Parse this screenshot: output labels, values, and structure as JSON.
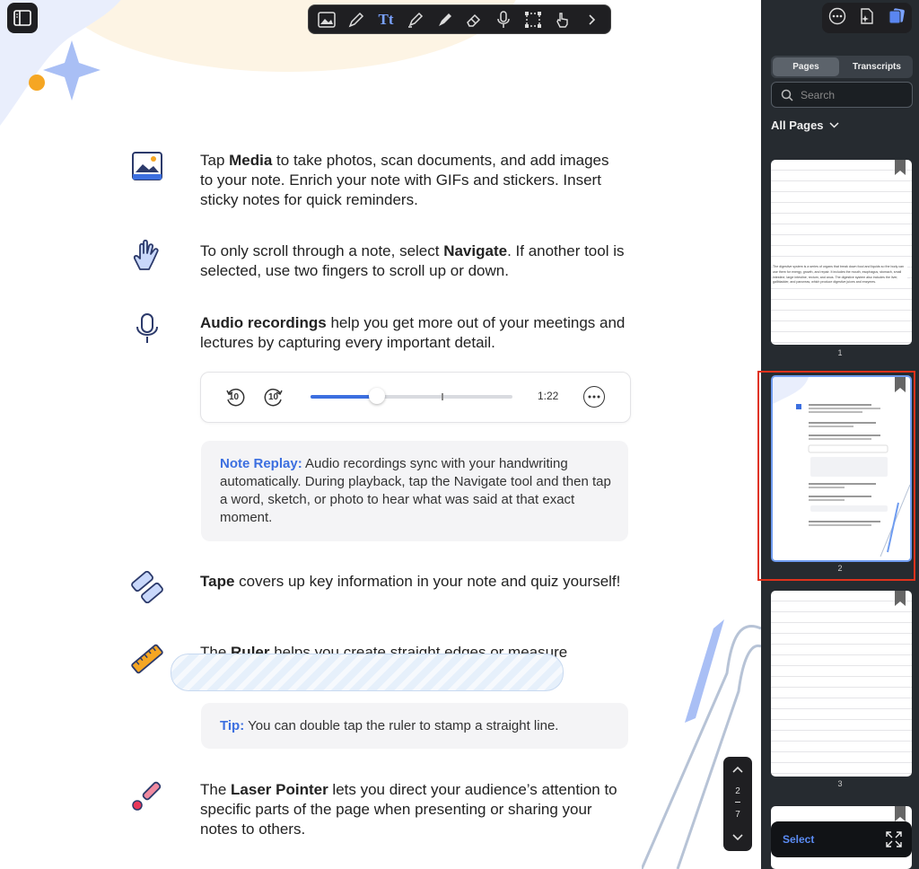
{
  "toolbar": {
    "tools": [
      "media-icon",
      "pen-icon",
      "text-icon",
      "highlighter-icon",
      "marker-icon",
      "eraser-icon",
      "microphone-icon",
      "lasso-icon",
      "navigate-icon",
      "chevron-right-icon"
    ]
  },
  "content": {
    "media": {
      "pre": "Tap ",
      "bold": "Media",
      "post": " to take photos, scan documents, and add images to your note. Enrich your note with GIFs and stickers. Insert sticky notes for quick reminders."
    },
    "navigate": {
      "pre": "To only scroll through a note, select ",
      "bold": "Navigate",
      "post": ". If another tool is selected, use two fingers to scroll up or down."
    },
    "audio": {
      "bold": "Audio recordings",
      "post": " help you get more out of your meetings and lectures by capturing every important detail."
    },
    "player": {
      "back_label": "10",
      "forward_label": "10",
      "time": "1:22",
      "progress": 0.33
    },
    "note_replay": {
      "title": "Note Replay:",
      "text": " Audio recordings sync with your handwriting automatically. During playback, tap the Navigate tool and then tap a word, sketch, or photo to hear what was said at that exact moment."
    },
    "tape": {
      "bold": "Tape",
      "post": " covers up key information in your note and quiz yourself!"
    },
    "ruler": {
      "pre": "The ",
      "bold": "Ruler",
      "post": " helps you create straight edges or measure"
    },
    "tip": {
      "title": "Tip:",
      "text": " You can double tap the ruler to stamp a straight line."
    },
    "laser": {
      "pre": "The ",
      "bold": "Laser Pointer",
      "post": " lets you direct your audience’s attention to specific parts of the page when presenting or sharing your notes to others."
    }
  },
  "page_indicator": {
    "current": "2",
    "total": "7"
  },
  "sidebar": {
    "tabs": [
      "Pages",
      "Transcripts"
    ],
    "active_tab": "Pages",
    "search_placeholder": "Search",
    "filter_label": "All Pages",
    "thumb1_text": "The digestive system is a series of organs that break down food and liquids so the body can use them for energy, growth, and repair. It includes the mouth, esophagus, stomach, small intestine, large intestine, rectum, and anus. The digestive system also includes the liver, gallbladder, and pancreas, which produce digestive juices and enzymes.",
    "pages": [
      "1",
      "2",
      "3"
    ],
    "select_label": "Select",
    "colors": {
      "selection": "#e0321c",
      "accent": "#3c6fe0"
    }
  }
}
